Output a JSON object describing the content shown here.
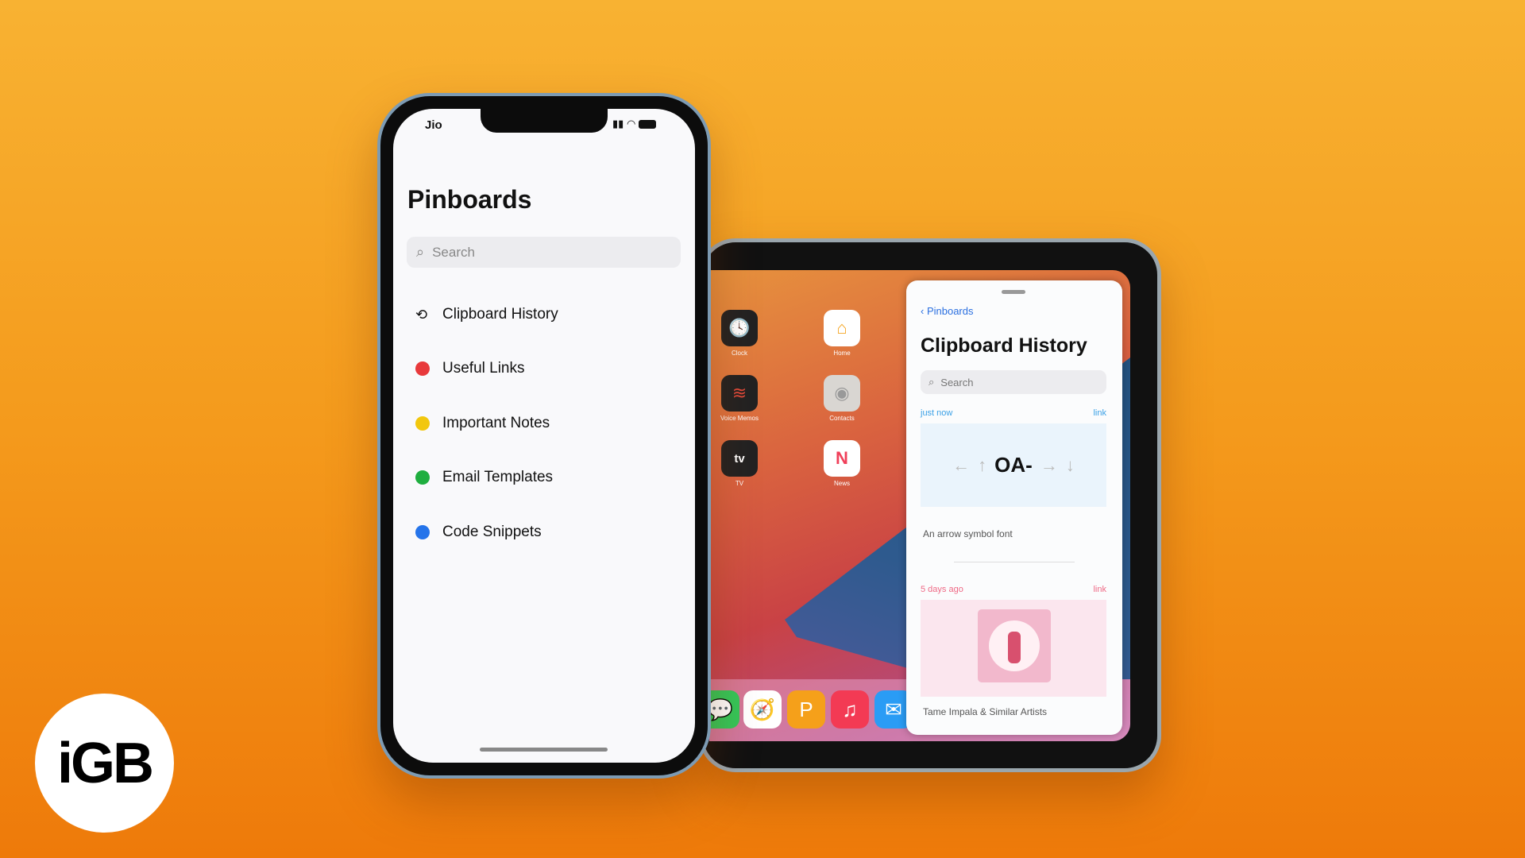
{
  "iphone": {
    "carrier": "Jio",
    "title": "Pinboards",
    "search_placeholder": "Search",
    "items": [
      {
        "label": "Clipboard History",
        "icon": "history-icon"
      },
      {
        "label": "Useful Links",
        "color": "#e8393b"
      },
      {
        "label": "Important Notes",
        "color": "#f2c70d"
      },
      {
        "label": "Email Templates",
        "color": "#1fae3f"
      },
      {
        "label": "Code Snippets",
        "color": "#2574ea"
      }
    ]
  },
  "ipad": {
    "apps": [
      {
        "label": "Clock"
      },
      {
        "label": "Home"
      },
      {
        "label": "Voice Memos"
      },
      {
        "label": "Contacts"
      },
      {
        "label": "TV",
        "glyph": "tv"
      },
      {
        "label": "News"
      }
    ],
    "panel": {
      "back_label": "Pinboards",
      "title": "Clipboard History",
      "search_placeholder": "Search",
      "entries": [
        {
          "time": "just now",
          "type": "link",
          "preview": "OA-",
          "caption": "An arrow symbol font",
          "accent": "#3aa0e6"
        },
        {
          "time": "5 days ago",
          "type": "link",
          "caption": "Tame Impala & Similar Artists",
          "accent": "#ef6a86"
        }
      ]
    }
  },
  "logo": "iGB"
}
